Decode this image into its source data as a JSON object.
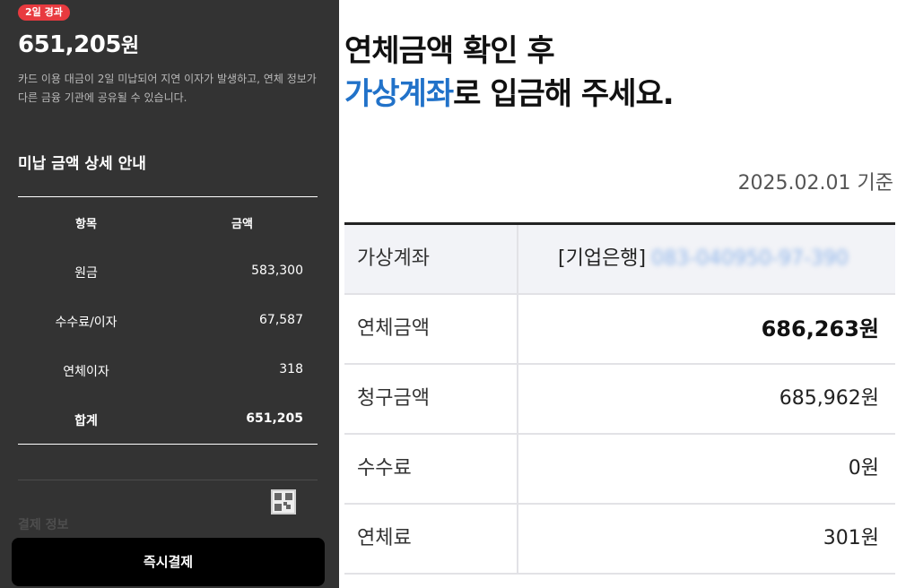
{
  "left": {
    "badge": "2일 경과",
    "amount_number": "651,205",
    "amount_unit": "원",
    "description": "카드 이용 대금이 2일 미납되어 지연 이자가 발생하고, 연체 정보가 다른 금융 기관에 공유될 수 있습니다.",
    "section_title": "미납 금액 상세 안내",
    "table": {
      "headers": [
        "항목",
        "금액"
      ],
      "rows": [
        {
          "label": "원금",
          "value": "583,300"
        },
        {
          "label": "수수료/이자",
          "value": "67,587"
        },
        {
          "label": "연체이자",
          "value": "318"
        }
      ],
      "total": {
        "label": "합계",
        "value": "651,205"
      }
    },
    "faded_section": "결제 정보",
    "pay_button": "즉시결제"
  },
  "right": {
    "heading_line1": "연체금액 확인 후",
    "heading_highlight": "가상계좌",
    "heading_rest": "로 입금해 주세요.",
    "as_of": "2025.02.01 기준",
    "rows": {
      "account": {
        "label": "가상계좌",
        "bank": "[기업은행]",
        "number": "083-040950-97-390"
      },
      "overdue": {
        "label": "연체금액",
        "value": "686,263원"
      },
      "billed": {
        "label": "청구금액",
        "value": "685,962원"
      },
      "fee": {
        "label": "수수료",
        "value": "0원"
      },
      "late_fee": {
        "label": "연체료",
        "value": "301원"
      }
    }
  },
  "colors": {
    "badge": "#e83a3f",
    "dark_panel": "#333333",
    "highlight": "#2172c9"
  }
}
